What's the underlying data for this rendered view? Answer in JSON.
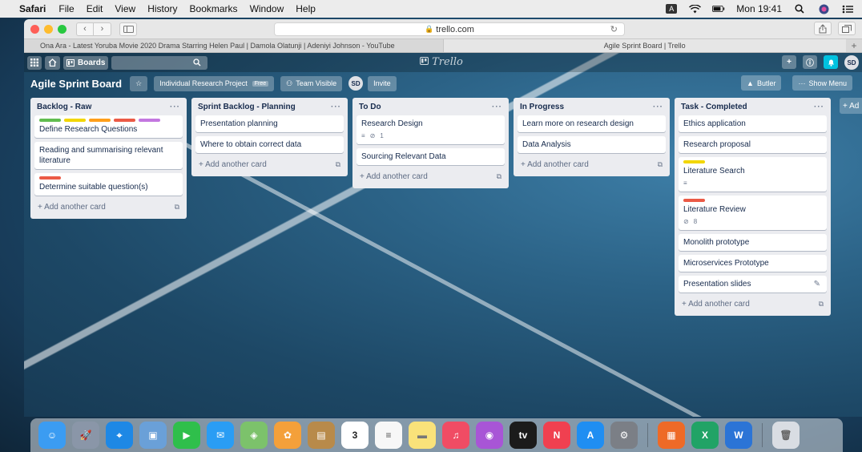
{
  "menubar": {
    "app_name": "Safari",
    "items": [
      "File",
      "Edit",
      "View",
      "History",
      "Bookmarks",
      "Window",
      "Help"
    ],
    "input_badge": "A",
    "clock": "Mon 19:41"
  },
  "browser": {
    "url": "trello.com",
    "tabs": [
      {
        "title": "Ona Ara - Latest Yoruba Movie 2020 Drama Starring Helen Paul | Damola Olatunji | Adeniyi Johnson - YouTube"
      },
      {
        "title": "Agile Sprint Board | Trello"
      }
    ]
  },
  "trello": {
    "header": {
      "boards_label": "Boards",
      "logo_text": "Trello",
      "avatar": "SD"
    },
    "board": {
      "title": "Agile Sprint Board",
      "workspace": "Individual Research Project",
      "workspace_badge": "Free",
      "visibility": "Team Visible",
      "member_avatar": "SD",
      "invite_label": "Invite",
      "butler_label": "Butler",
      "show_menu_label": "Show Menu"
    },
    "add_card_label": "+ Add another card",
    "add_list_label": "+ Ad",
    "lists": [
      {
        "name": "Backlog - Raw",
        "cards": [
          {
            "title": "Define Research Questions",
            "labels": [
              "#61bd4f",
              "#f2d600",
              "#ff9f1a",
              "#eb5a46",
              "#c377e0"
            ]
          },
          {
            "title": "Reading and summarising relevant literature",
            "labels": []
          },
          {
            "title": "Determine suitable question(s)",
            "labels": [
              "#eb5a46"
            ]
          }
        ]
      },
      {
        "name": "Sprint Backlog - Planning",
        "cards": [
          {
            "title": "Presentation planning",
            "labels": []
          },
          {
            "title": "Where to obtain correct data",
            "labels": []
          }
        ]
      },
      {
        "name": "To Do",
        "cards": [
          {
            "title": "Research Design",
            "labels": [],
            "attachments": "1",
            "has_description": true
          },
          {
            "title": "Sourcing Relevant Data",
            "labels": []
          }
        ]
      },
      {
        "name": "In Progress",
        "cards": [
          {
            "title": "Learn more on research design",
            "labels": []
          },
          {
            "title": "Data Analysis",
            "labels": []
          }
        ]
      },
      {
        "name": "Task - Completed",
        "cards": [
          {
            "title": "Ethics application",
            "labels": []
          },
          {
            "title": "Research proposal",
            "labels": []
          },
          {
            "title": "Literature Search",
            "labels": [
              "#f2d600"
            ],
            "has_description": true
          },
          {
            "title": "Literature Review",
            "labels": [
              "#eb5a46"
            ],
            "attachments": "8"
          },
          {
            "title": "Monolith prototype",
            "labels": []
          },
          {
            "title": "Microservices Prototype",
            "labels": []
          },
          {
            "title": "Presentation slides",
            "labels": [],
            "editing": true
          }
        ]
      }
    ]
  },
  "dock": {
    "apps": [
      {
        "name": "Finder",
        "color": "#3b9cf2",
        "glyph": "☺"
      },
      {
        "name": "Launchpad",
        "color": "#8a96a8",
        "glyph": "🚀"
      },
      {
        "name": "Safari",
        "color": "#1e88e5",
        "glyph": "⌖"
      },
      {
        "name": "Preview",
        "color": "#6aa0d8",
        "glyph": "▣"
      },
      {
        "name": "FaceTime",
        "color": "#2fbf4b",
        "glyph": "▶"
      },
      {
        "name": "Messages",
        "color": "#2a9df4",
        "glyph": "✉"
      },
      {
        "name": "Maps",
        "color": "#7cc26b",
        "glyph": "◈"
      },
      {
        "name": "Photos",
        "color": "#f4a03a",
        "glyph": "✿"
      },
      {
        "name": "Contacts",
        "color": "#b88a4a",
        "glyph": "▤"
      },
      {
        "name": "Calendar",
        "color": "#ffffff",
        "glyph": "3",
        "text_color": "#222"
      },
      {
        "name": "Reminders",
        "color": "#f7f7f7",
        "glyph": "≡",
        "text_color": "#555"
      },
      {
        "name": "Notes",
        "color": "#f9e27a",
        "glyph": "▬",
        "text_color": "#777"
      },
      {
        "name": "Music",
        "color": "#f04c64",
        "glyph": "♫"
      },
      {
        "name": "Podcasts",
        "color": "#a855d6",
        "glyph": "◉"
      },
      {
        "name": "TV",
        "color": "#1b1b1b",
        "glyph": "tv"
      },
      {
        "name": "News",
        "color": "#f04050",
        "glyph": "N"
      },
      {
        "name": "App Store",
        "color": "#1f8ef2",
        "glyph": "A"
      },
      {
        "name": "System Preferences",
        "color": "#7b7f86",
        "glyph": "⚙"
      },
      {
        "name": "PowerPoint-like",
        "color": "#ee6a27",
        "glyph": "▦"
      },
      {
        "name": "Excel",
        "color": "#21a366",
        "glyph": "X"
      },
      {
        "name": "Word",
        "color": "#2b74d6",
        "glyph": "W"
      },
      {
        "name": "Trash",
        "color": "#d9dde3",
        "glyph": "🗑",
        "text_color": "#666"
      }
    ]
  }
}
